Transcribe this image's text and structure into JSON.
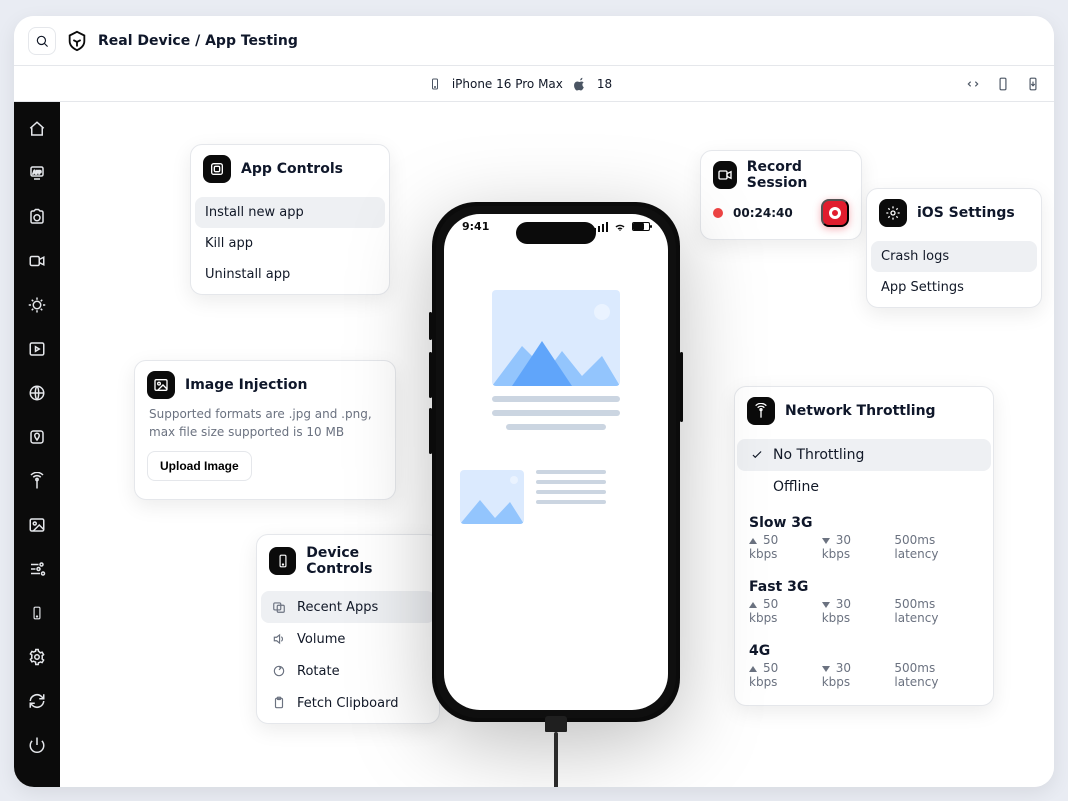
{
  "header": {
    "breadcrumb": "Real Device / App Testing",
    "device": "iPhone 16 Pro Max",
    "os": "18"
  },
  "phone": {
    "clock": "9:41"
  },
  "cards": {
    "appControls": {
      "title": "App Controls",
      "items": [
        "Install new app",
        "Kill app",
        "Uninstall app"
      ]
    },
    "imageInjection": {
      "title": "Image Injection",
      "desc": "Supported formats are .jpg and .png, max file size supported is 10 MB",
      "button": "Upload Image"
    },
    "deviceControls": {
      "title": "Device Controls",
      "items": [
        "Recent Apps",
        "Volume",
        "Rotate",
        "Fetch Clipboard"
      ]
    },
    "record": {
      "title": "Record Session",
      "time": "00:24:40"
    },
    "iosSettings": {
      "title": "iOS Settings",
      "items": [
        "Crash logs",
        "App Settings"
      ]
    },
    "network": {
      "title": "Network Throttling",
      "options": [
        "No Throttling",
        "Offline"
      ],
      "profiles": [
        {
          "name": "Slow 3G",
          "up": "50 kbps",
          "down": "30 kbps",
          "lat": "500ms latency"
        },
        {
          "name": "Fast 3G",
          "up": "50 kbps",
          "down": "30 kbps",
          "lat": "500ms latency"
        },
        {
          "name": "4G",
          "up": "50 kbps",
          "down": "30 kbps",
          "lat": "500ms latency"
        }
      ]
    }
  }
}
